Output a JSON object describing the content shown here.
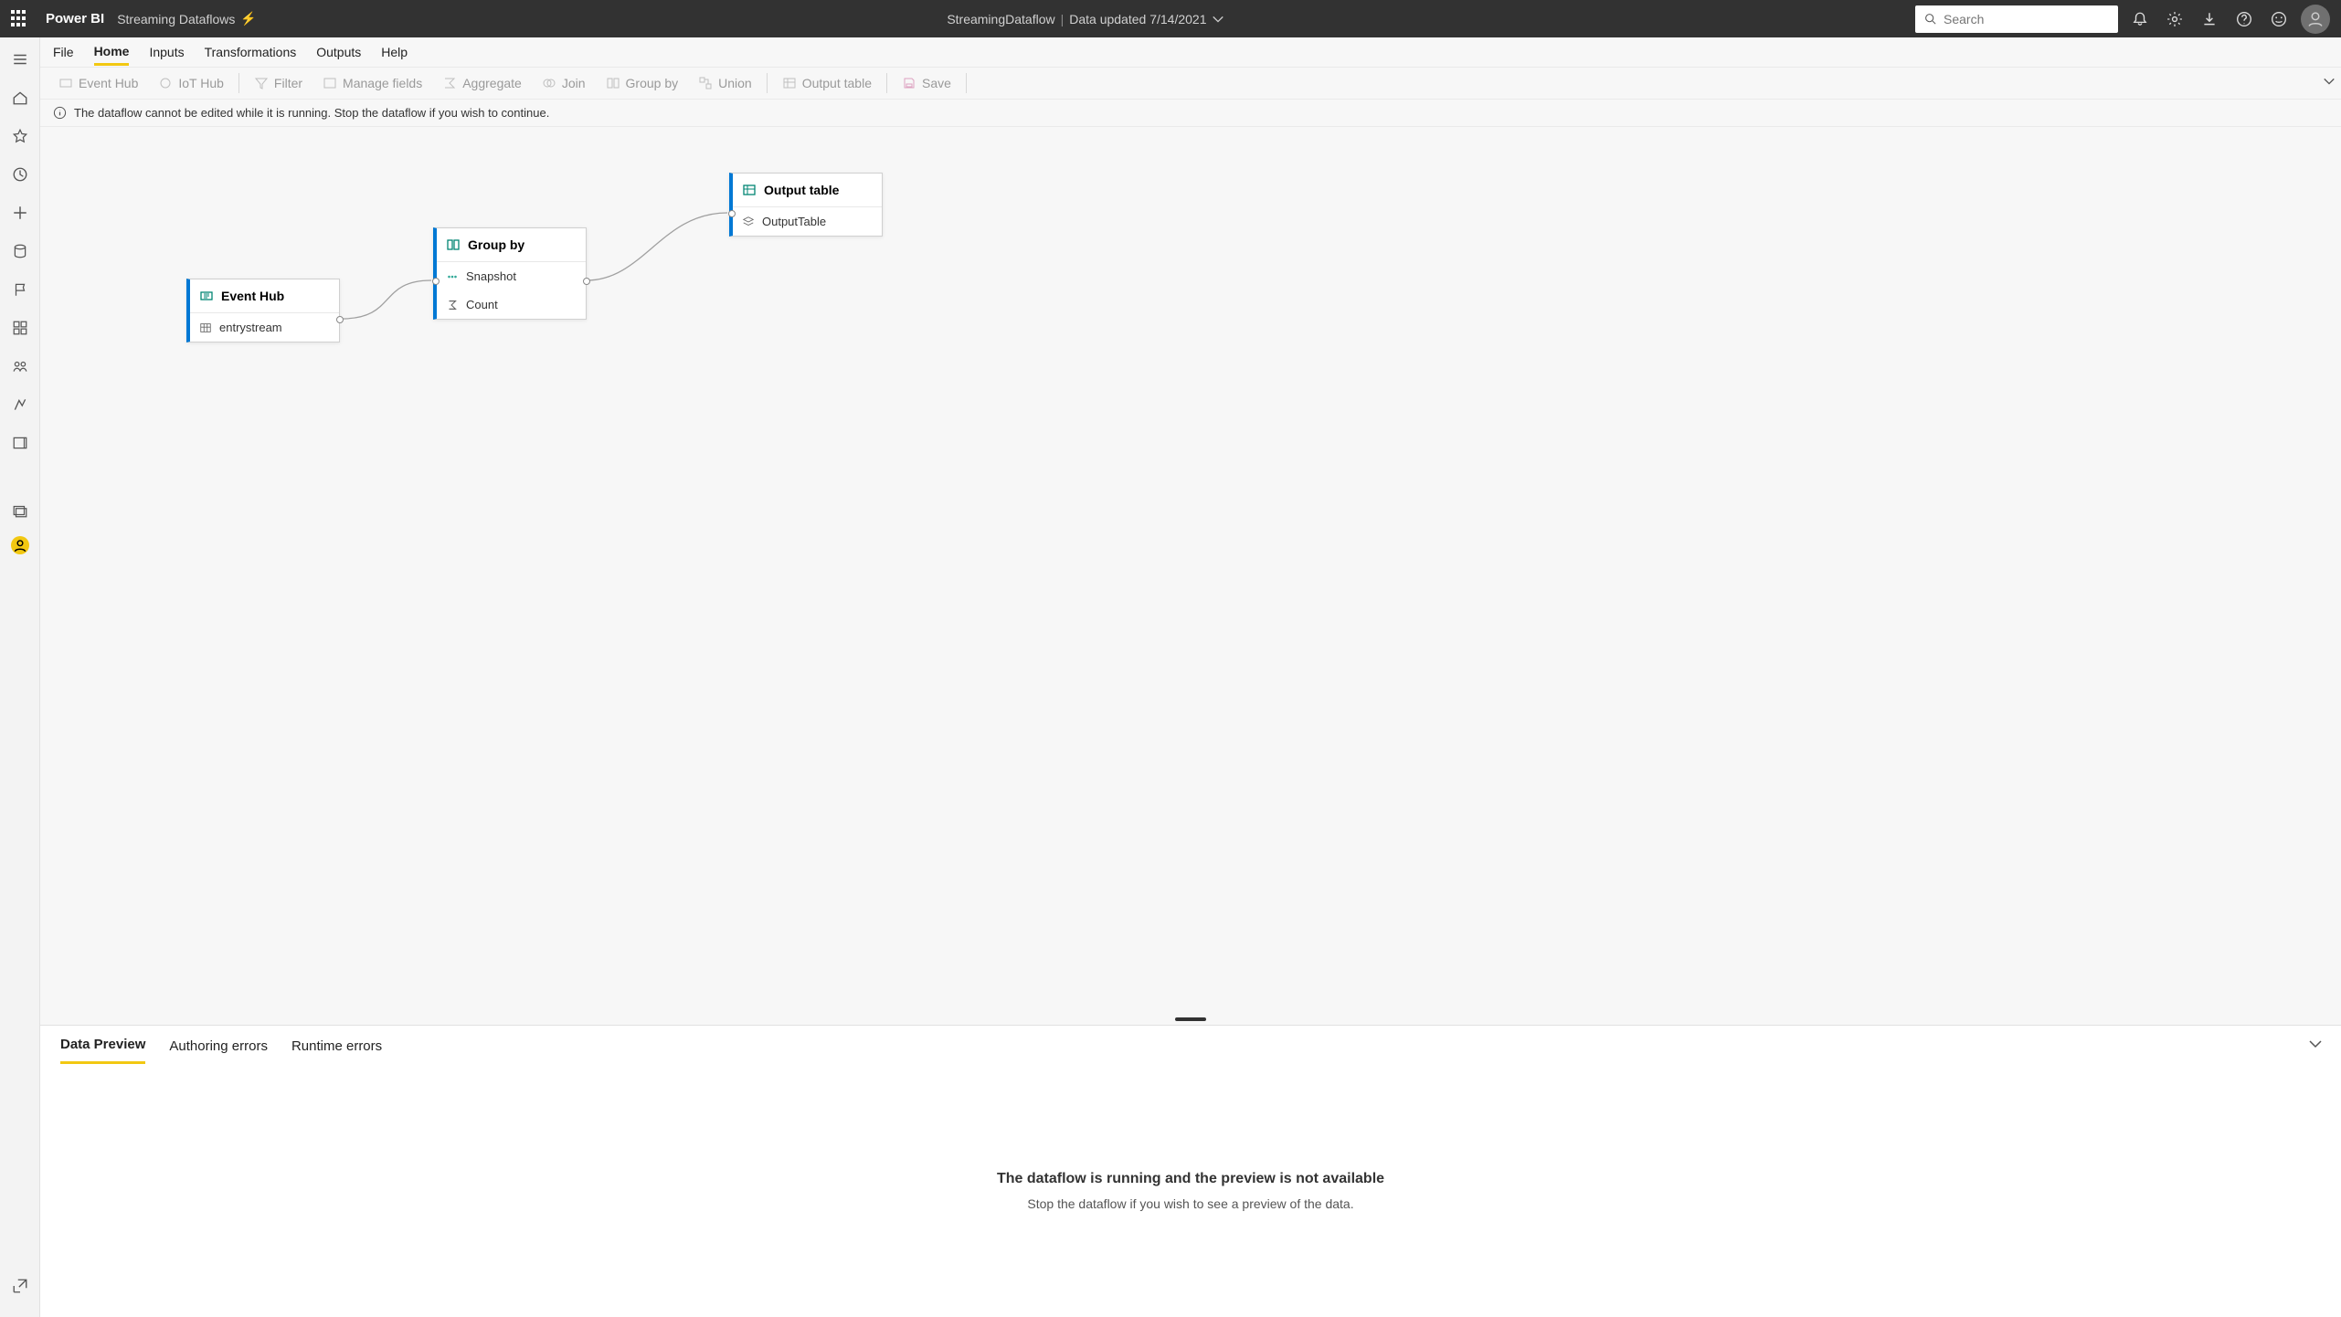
{
  "header": {
    "brand": "Power BI",
    "workspace": "Streaming Dataflows",
    "center_title": "StreamingDataflow",
    "center_status": "Data updated 7/14/2021",
    "search_placeholder": "Search"
  },
  "menubar": {
    "items": [
      "File",
      "Home",
      "Inputs",
      "Transformations",
      "Outputs",
      "Help"
    ],
    "active": "Home"
  },
  "ribbon": {
    "items": [
      "Event Hub",
      "IoT Hub",
      "Filter",
      "Manage fields",
      "Aggregate",
      "Join",
      "Group by",
      "Union",
      "Output table",
      "Save"
    ]
  },
  "infobar": {
    "message": "The dataflow cannot be edited while it is running. Stop the dataflow if you wish to continue."
  },
  "canvas": {
    "nodes": {
      "eventhub": {
        "title": "Event Hub",
        "row1": "entrystream"
      },
      "groupby": {
        "title": "Group by",
        "row1": "Snapshot",
        "row2": "Count"
      },
      "output": {
        "title": "Output table",
        "row1": "OutputTable"
      }
    }
  },
  "bottom": {
    "tabs": [
      "Data Preview",
      "Authoring errors",
      "Runtime errors"
    ],
    "active": "Data Preview",
    "message_title": "The dataflow is running and the preview is not available",
    "message_sub": "Stop the dataflow if you wish to see a preview of the data."
  }
}
